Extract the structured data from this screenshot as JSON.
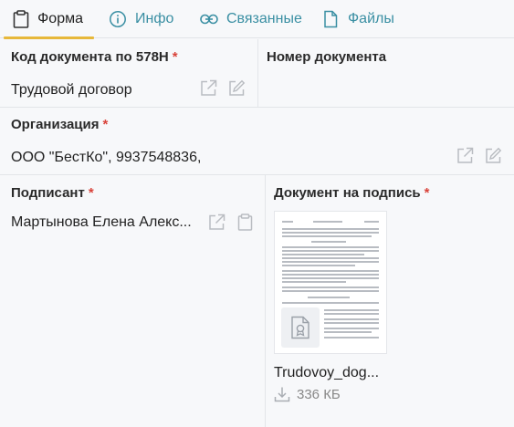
{
  "tabs": [
    {
      "label": "Форма",
      "icon": "clipboard-icon",
      "active": true
    },
    {
      "label": "Инфо",
      "icon": "info-icon"
    },
    {
      "label": "Связанные",
      "icon": "link-icon"
    },
    {
      "label": "Файлы",
      "icon": "file-icon"
    }
  ],
  "fields": {
    "doc_code": {
      "label": "Код документа по 578Н",
      "required": "*",
      "value": "Трудовой договор"
    },
    "doc_number": {
      "label": "Номер документа"
    },
    "organization": {
      "label": "Организация",
      "required": "*",
      "value": "ООО \"БестКо\", 9937548836,"
    },
    "signer": {
      "label": "Подписант",
      "required": "*",
      "value": "Мартынова Елена Алекс..."
    },
    "doc_to_sign": {
      "label": "Документ на подпись",
      "required": "*",
      "file_name": "Trudovoy_dog...",
      "file_size": "336 КБ"
    }
  },
  "colors": {
    "accent": "#3a8fa3",
    "required": "#d9433a",
    "active_underline": "#e7b83a"
  }
}
